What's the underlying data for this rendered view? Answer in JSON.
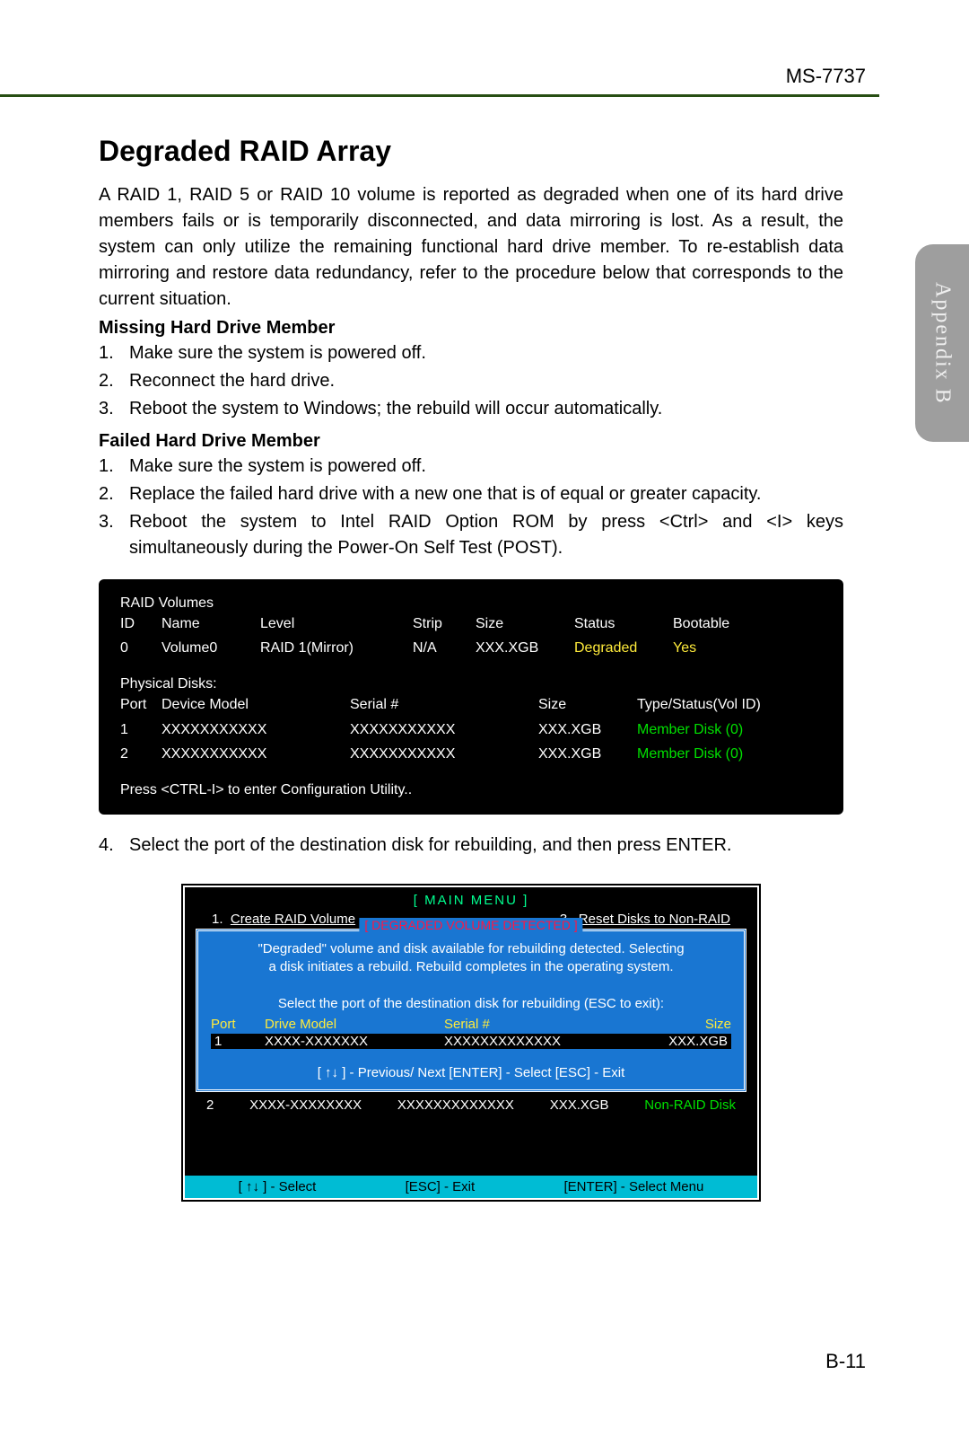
{
  "header": {
    "code": "MS-7737"
  },
  "sidebar": {
    "label": "Appendix B"
  },
  "page": {
    "number": "B-11"
  },
  "title": "Degraded RAID Array",
  "intro": "A RAID 1, RAID 5 or RAID 10 volume is reported as degraded when one of its hard drive members fails or is temporarily disconnected, and data mirroring is lost. As a result, the system can only utilize the remaining functional hard drive member. To re-establish data mirroring and restore data redundancy, refer to the procedure below that corresponds to the current situation.",
  "sections": {
    "missing": {
      "heading": "Missing Hard Drive Member",
      "items": [
        "Make sure the system is powered off.",
        "Reconnect the hard drive.",
        "Reboot the system to Windows; the rebuild will occur automatically."
      ]
    },
    "failed": {
      "heading": "Failed Hard Drive Member",
      "items": [
        "Make sure the system is powered off.",
        "Replace the failed hard drive with a new one that is of equal or greater capacity.",
        "Reboot the system to Intel RAID Option ROM by press <Ctrl> and <I> keys simultaneously during the Power-On Self Test (POST)."
      ],
      "item4": "Select the port of the destination disk for rebuilding, and then press ENTER."
    }
  },
  "term1": {
    "raid_volumes_label": "RAID Volumes",
    "headers": {
      "id": "ID",
      "name": "Name",
      "level": "Level",
      "strip": "Strip",
      "size": "Size",
      "status": "Status",
      "boot": "Bootable"
    },
    "row": {
      "id": "0",
      "name": "Volume0",
      "level": "RAID 1(Mirror)",
      "strip": "N/A",
      "size": "XXX.XGB",
      "status": "Degraded",
      "boot": "Yes"
    },
    "physical_label": "Physical Disks:",
    "pd_headers": {
      "port": "Port",
      "model": "Device Model",
      "serial": "Serial #",
      "size": "Size",
      "type": "Type/Status(Vol ID)"
    },
    "pd_rows": [
      {
        "port": "1",
        "model": "XXXXXXXXXXX",
        "serial": "XXXXXXXXXXX",
        "size": "XXX.XGB",
        "type": "Member  Disk (0)"
      },
      {
        "port": "2",
        "model": "XXXXXXXXXXX",
        "serial": "XXXXXXXXXXX",
        "size": "XXX.XGB",
        "type": "Member  Disk (0)"
      }
    ],
    "footer": "Press  <CTRL-I>  to enter Configuration Utility.."
  },
  "term2": {
    "main_menu": "[   MAIN  MENU   ]",
    "menu_left": {
      "num": "1.",
      "label": "Create  RAID  Volume"
    },
    "menu_right": {
      "num": "3.",
      "label": "Reset Disks to Non-RAID"
    },
    "red_title": "[  DEGRADED VOLUME DETECTED  ]",
    "msg1": "\"Degraded\" volume and disk available for rebuilding detected. Selecting",
    "msg2": "a disk initiates a rebuild. Rebuild completes in the  operating system.",
    "msg3": "Select the port of the destination disk for rebuilding (ESC to exit):",
    "cols": {
      "port": "Port",
      "drive": "Drive  Model",
      "serial": "Serial  #",
      "size": "Size"
    },
    "row": {
      "port": "1",
      "drive": "XXXX-XXXXXXX",
      "serial": "XXXXXXXXXXXXX",
      "size": "XXX.XGB"
    },
    "panel_footer": "[ ↑↓ ] - Previous/ Next     [ENTER] - Select     [ESC] - Exit",
    "bg_frag": {
      "a": "XXXX-XXXXXXXX",
      "b": "XXXXXXXXXXXXX",
      "c": "XXX.XGB",
      "d": "Non-RAID  Disk"
    },
    "bottom": {
      "a": "[ ↑↓ ] - Select",
      "b": "[ESC] - Exit",
      "c": "[ENTER] - Select Menu"
    }
  }
}
